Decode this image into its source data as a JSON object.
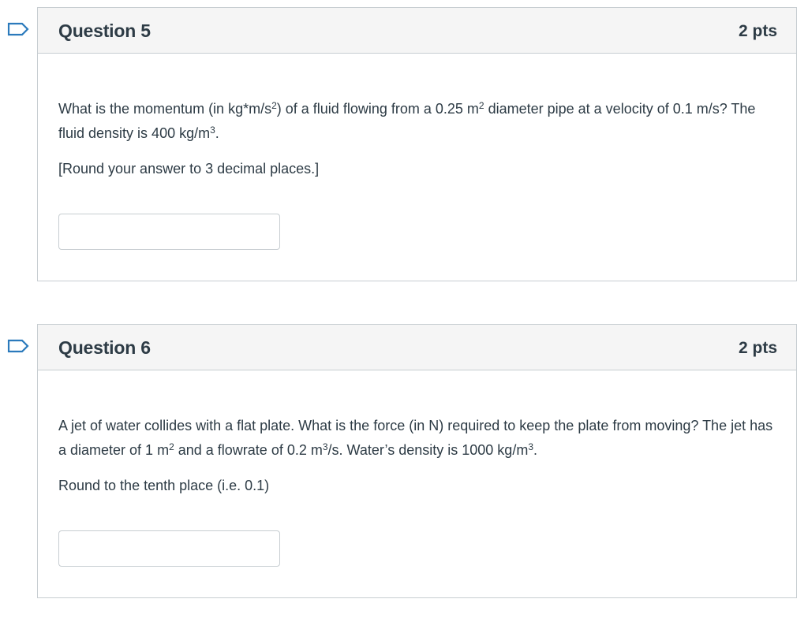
{
  "questions": [
    {
      "title": "Question 5",
      "points": "2 pts",
      "text": {
        "a": "What is the momentum (in kg*m/s",
        "a_sup": "2",
        "b": ") of a fluid flowing from a 0.25 m",
        "b_sup": "2",
        "c": " diameter pipe at a velocity of 0.1 m/s? The fluid density is 400 kg/m",
        "c_sup": "3",
        "d": "."
      },
      "note": "[Round your answer to 3 decimal places.]",
      "answer_value": "",
      "flag_icon": "flag-outline-icon"
    },
    {
      "title": "Question 6",
      "points": "2 pts",
      "text": {
        "a": "A jet of water collides with a flat plate. What is the force (in N) required to keep the plate from moving? The jet has a diameter of 1 m",
        "a_sup": "2",
        "b": " and a flowrate of 0.2 m",
        "b_sup": "3",
        "c": "/s. Water’s density is 1000 kg/m",
        "c_sup": "3",
        "d": "."
      },
      "note": "Round to the tenth place (i.e. 0.1)",
      "answer_value": "",
      "flag_icon": "flag-outline-icon"
    }
  ],
  "colors": {
    "flag": "#2b7abc",
    "border": "#c7cdd1",
    "header_bg": "#f5f5f5",
    "text": "#2d3b45"
  }
}
